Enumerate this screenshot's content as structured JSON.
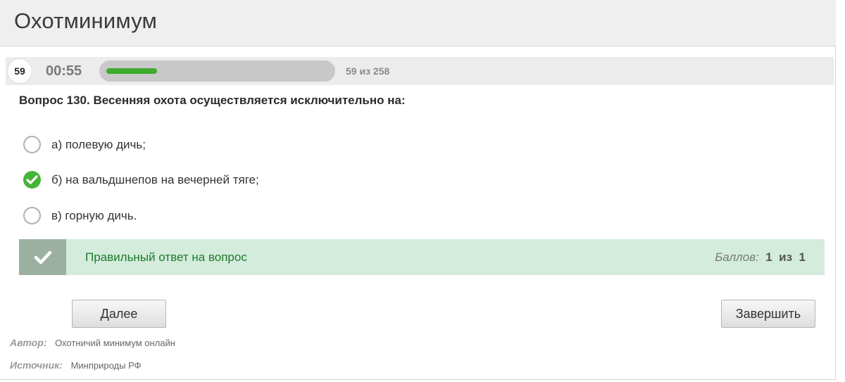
{
  "header": {
    "title": "Охотминимум"
  },
  "progress": {
    "question_number": "59",
    "timer": "00:55",
    "fraction": 0.229,
    "fill_color": "#3eab2c",
    "counter": "59 из 258"
  },
  "question": {
    "text": "Вопрос 130. Весенняя охота осуществляется исключительно на:"
  },
  "options": [
    {
      "label": "а) полевую дичь;",
      "selected": false
    },
    {
      "label": "б) на вальдшнепов на вечерней тяге;",
      "selected": true
    },
    {
      "label": "в) горную дичь.",
      "selected": false
    }
  ],
  "result": {
    "message": "Правильный ответ на вопрос",
    "score_label": "Баллов:",
    "score_value": "1",
    "score_sep": "из",
    "score_max": "1",
    "bg_color": "#d3ecdc",
    "text_color": "#1f7a2c"
  },
  "buttons": {
    "next": "Далее",
    "finish": "Завершить"
  },
  "meta": {
    "author_label": "Автор:",
    "author_value": "Охотничий минимум онлайн",
    "source_label": "Источник:",
    "source_value": "Минприроды РФ"
  },
  "icons": {
    "check": "check-icon",
    "radio": "radio-icon"
  }
}
